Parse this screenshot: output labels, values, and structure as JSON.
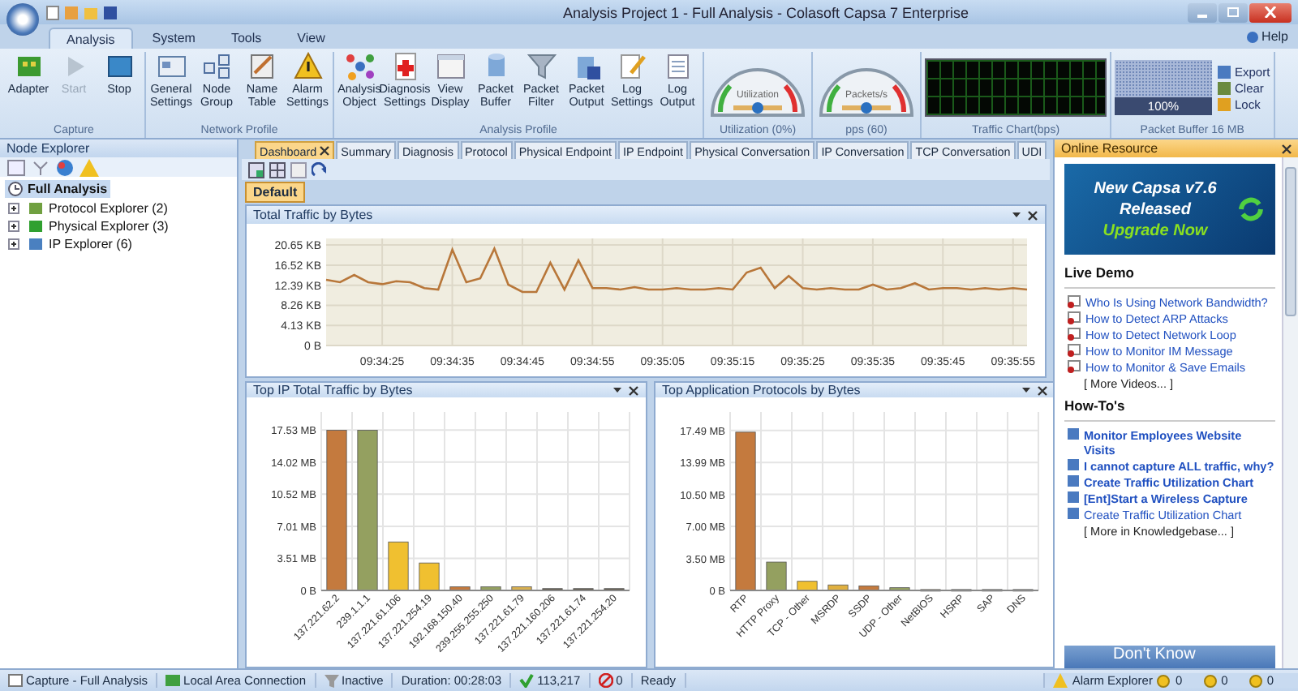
{
  "window": {
    "title": "Analysis Project 1 - Full Analysis - Colasoft Capsa 7 Enterprise"
  },
  "ribbon_tabs": [
    {
      "label": "Analysis",
      "selected": true
    },
    {
      "label": "System",
      "selected": false
    },
    {
      "label": "Tools",
      "selected": false
    },
    {
      "label": "View",
      "selected": false
    }
  ],
  "help": "Help",
  "ribbon_groups": [
    {
      "label": "Capture",
      "buttons": [
        {
          "label": "Adapter",
          "disabled": false
        },
        {
          "label": "Start",
          "disabled": true
        },
        {
          "label": "Stop",
          "disabled": false
        }
      ]
    },
    {
      "label": "Network Profile",
      "buttons": [
        {
          "label": "General Settings",
          "disabled": false
        },
        {
          "label": "Node Group",
          "disabled": false
        },
        {
          "label": "Name Table",
          "disabled": false
        },
        {
          "label": "Alarm Settings",
          "disabled": false
        }
      ]
    },
    {
      "label": "Analysis Profile",
      "buttons": [
        {
          "label": "Analysis Object",
          "disabled": false
        },
        {
          "label": "Diagnosis Settings",
          "disabled": false
        },
        {
          "label": "View Display",
          "disabled": false
        },
        {
          "label": "Packet Buffer",
          "disabled": false
        },
        {
          "label": "Packet Filter",
          "disabled": false
        },
        {
          "label": "Packet Output",
          "disabled": false
        },
        {
          "label": "Log Settings",
          "disabled": false
        },
        {
          "label": "Log Output",
          "disabled": false
        }
      ]
    }
  ],
  "gauges": [
    {
      "dial_label": "Utilization",
      "label": "Utilization (0%)"
    },
    {
      "dial_label": "Packets/s",
      "label": "pps (60)"
    }
  ],
  "traffic_chart": {
    "label": "Traffic Chart(bps)"
  },
  "packet_buffer": {
    "level": 1,
    "reading": "100%",
    "label": "Packet Buffer 16 MB",
    "actions": [
      "Export",
      "Clear",
      "Lock"
    ]
  },
  "node_explorer": {
    "title": "Node Explorer",
    "tree": [
      {
        "label": "Full Analysis",
        "selected": true,
        "children": [
          {
            "label": "Protocol Explorer (2)",
            "selected": false
          },
          {
            "label": "Physical Explorer (3)",
            "selected": false
          },
          {
            "label": "IP Explorer (6)",
            "selected": false
          }
        ]
      }
    ]
  },
  "view_tabs": [
    {
      "label": "Dashboard",
      "selected": true
    },
    {
      "label": "Summary",
      "selected": false
    },
    {
      "label": "Diagnosis",
      "selected": false
    },
    {
      "label": "Protocol",
      "selected": false
    },
    {
      "label": "Physical Endpoint",
      "selected": false
    },
    {
      "label": "IP Endpoint",
      "selected": false
    },
    {
      "label": "Physical Conversation",
      "selected": false
    },
    {
      "label": "IP Conversation",
      "selected": false
    },
    {
      "label": "TCP Conversation",
      "selected": false
    },
    {
      "label": "UDI",
      "selected": false
    }
  ],
  "dashboard_tabs": [
    {
      "label": "Default",
      "selected": true
    }
  ],
  "total_traffic": {
    "title": "Total Traffic by Bytes",
    "chart_data": {
      "type": "line",
      "ylim": [
        0,
        22
      ],
      "grid": true,
      "categories": [
        null,
        null,
        null,
        null,
        "09:34:25",
        null,
        null,
        null,
        null,
        "09:34:35",
        null,
        null,
        null,
        null,
        "09:34:45",
        null,
        null,
        null,
        null,
        "09:34:55",
        null,
        null,
        null,
        null,
        "09:35:05",
        null,
        null,
        null,
        null,
        "09:35:15",
        null,
        null,
        null,
        null,
        "09:35:25",
        null,
        null,
        null,
        null,
        "09:35:35",
        null,
        null,
        null,
        null,
        "09:35:45",
        null,
        null,
        null,
        null,
        "09:35:55",
        null
      ],
      "series": [
        {
          "color": "#b8773a",
          "values": [
            13.5,
            13,
            14.5,
            13,
            12.6,
            13.2,
            13,
            11.8,
            11.5,
            19.7,
            13,
            13.8,
            19.9,
            12.5,
            11,
            11,
            17,
            11.5,
            17.5,
            11.8,
            11.8,
            11.5,
            12,
            11.5,
            11.5,
            11.8,
            11.5,
            11.5,
            11.8,
            11.5,
            15,
            16,
            11.8,
            14.3,
            11.8,
            11.5,
            11.8,
            11.5,
            11.5,
            12.5,
            11.5,
            11.8,
            12.8,
            11.5,
            11.8,
            11.8,
            11.5,
            11.8,
            11.5,
            11.8,
            11.5
          ]
        }
      ],
      "yticks": [
        {
          "value": 0,
          "label": "0 B"
        },
        {
          "value": 4.13,
          "label": "4.13 KB"
        },
        {
          "value": 8.26,
          "label": "8.26 KB"
        },
        {
          "value": 12.39,
          "label": "12.39 KB"
        },
        {
          "value": 16.52,
          "label": "16.52 KB"
        },
        {
          "value": 20.65,
          "label": "20.65 KB"
        }
      ]
    }
  },
  "bar_panels": [
    {
      "title": "Top IP Total Traffic by Bytes",
      "chart_data": {
        "type": "bar",
        "ylim": [
          0,
          19.5
        ],
        "grid": true,
        "categories": [
          "137.221.62.2",
          "239.1.1.1",
          "137.221.61.106",
          "137.221.254.19",
          "192.168.150.40",
          "239.255.255.250",
          "137.221.61.79",
          "137.221.160.206",
          "137.221.61.74",
          "137.221.254.20"
        ],
        "values": [
          17.5,
          17.5,
          5.3,
          3.0,
          0.4,
          0.4,
          0.4,
          0.2,
          0.2,
          0.2
        ],
        "colors": [
          "#c47a3e",
          "#94a060",
          "#f0c030",
          "#f0c030",
          "#c47a3e",
          "#94a060",
          "#d8b050",
          "#605848",
          "#605848",
          "#605848"
        ],
        "yticks": [
          {
            "value": 0,
            "label": "0 B"
          },
          {
            "value": 3.51,
            "label": "3.51 MB"
          },
          {
            "value": 7.01,
            "label": "7.01 MB"
          },
          {
            "value": 10.52,
            "label": "10.52 MB"
          },
          {
            "value": 14.02,
            "label": "14.02 MB"
          },
          {
            "value": 17.53,
            "label": "17.53 MB"
          }
        ]
      }
    },
    {
      "title": "Top Application Protocols by Bytes",
      "chart_data": {
        "type": "bar",
        "ylim": [
          0,
          19.5
        ],
        "grid": true,
        "categories": [
          "RTP",
          "HTTP Proxy",
          "TCP - Other",
          "MSRDP",
          "SSDP",
          "UDP - Other",
          "NetBIOS",
          "HSRP",
          "SAP",
          "DNS"
        ],
        "values": [
          17.3,
          3.1,
          1.0,
          0.6,
          0.5,
          0.3,
          0.1,
          0.1,
          0.1,
          0.1
        ],
        "colors": [
          "#c47a3e",
          "#94a060",
          "#f0c030",
          "#e0b040",
          "#c47a3e",
          "#94a060",
          "#d8b050",
          "#605848",
          "#605848",
          "#605848"
        ],
        "yticks": [
          {
            "value": 0,
            "label": "0 B"
          },
          {
            "value": 3.5,
            "label": "3.50 MB"
          },
          {
            "value": 7.0,
            "label": "7.00 MB"
          },
          {
            "value": 10.5,
            "label": "10.50 MB"
          },
          {
            "value": 13.99,
            "label": "13.99 MB"
          },
          {
            "value": 17.49,
            "label": "17.49 MB"
          }
        ]
      }
    }
  ],
  "online_resource": {
    "title": "Online Resource",
    "banner": [
      "New Capsa v7.6",
      "Released",
      "Upgrade Now"
    ],
    "sections": [
      {
        "title": "Live Demo",
        "kind": "video",
        "links": [
          "Who Is Using Network Bandwidth?",
          "How to Detect ARP Attacks",
          "How to Detect Network Loop",
          "How to Monitor IM Message",
          "How to Monitor & Save Emails"
        ],
        "more": "[ More Videos... ]"
      },
      {
        "title": "How-To's",
        "kind": "article",
        "links": [
          "Monitor Employees Website Visits",
          "I cannot capture ALL traffic, why?",
          "Create Traffic Utilization Chart",
          "[Ent]Start a Wireless Capture",
          "Create Traffic Utilization Chart"
        ],
        "more": "[ More in Knowledgebase... ]"
      }
    ],
    "bottom_banner": "Don't Know"
  },
  "status_bar": {
    "items": [
      "Capture - Full Analysis",
      "Local Area Connection",
      "Inactive",
      "Duration: 00:28:03",
      "113,217",
      "0",
      "Ready"
    ],
    "alarm_explorer": "Alarm Explorer",
    "alarm_counts": [
      "0",
      "0",
      "0"
    ]
  }
}
